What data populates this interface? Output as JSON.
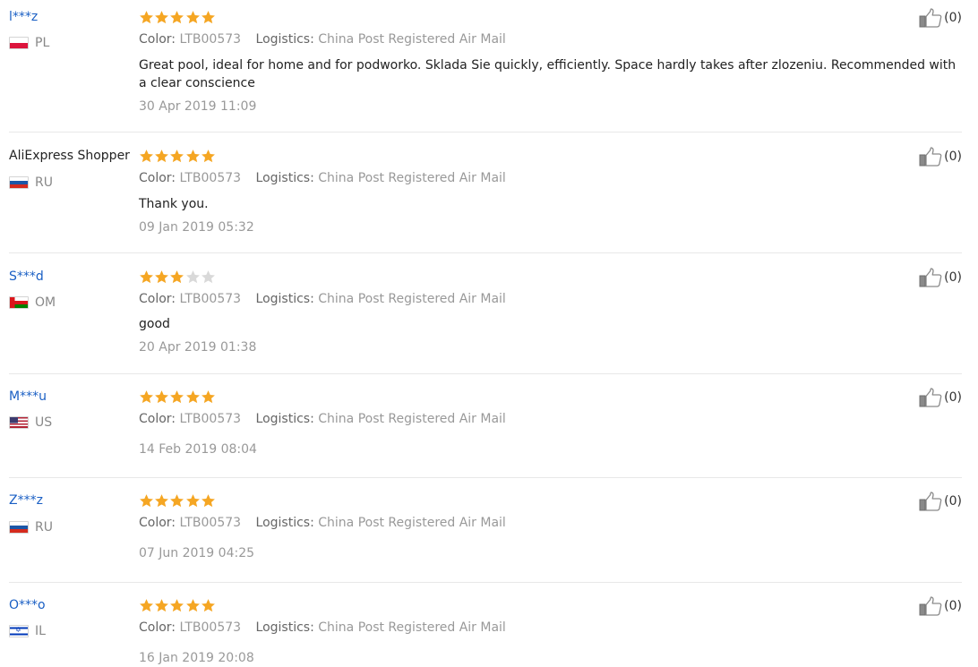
{
  "labels": {
    "color": "Color:",
    "logistics": "Logistics:"
  },
  "colors": {
    "star_filled": "#f5a623",
    "star_empty": "#d9d9d9",
    "username": "#1a5fc4"
  },
  "reviews": [
    {
      "user": "l***z",
      "country": "PL",
      "rating": 5,
      "color_value": "LTB00573",
      "logistics_value": "China Post Registered Air Mail",
      "feedback": "Great pool, ideal for home and for podworko. Sklada Sie quickly, efficiently. Space hardly takes after zlozeniu. Recommended with a clear conscience",
      "date": "30 Apr 2019 11:09",
      "helpful": "(0)"
    },
    {
      "user": "AliExpress Shopper",
      "country": "RU",
      "rating": 5,
      "color_value": "LTB00573",
      "logistics_value": "China Post Registered Air Mail",
      "feedback": "Thank you.",
      "date": "09 Jan 2019 05:32",
      "helpful": "(0)"
    },
    {
      "user": "S***d",
      "country": "OM",
      "rating": 3,
      "color_value": "LTB00573",
      "logistics_value": "China Post Registered Air Mail",
      "feedback": "good",
      "date": "20 Apr 2019 01:38",
      "helpful": "(0)"
    },
    {
      "user": "M***u",
      "country": "US",
      "rating": 5,
      "color_value": "LTB00573",
      "logistics_value": "China Post Registered Air Mail",
      "feedback": "",
      "date": "14 Feb 2019 08:04",
      "helpful": "(0)"
    },
    {
      "user": "Z***z",
      "country": "RU",
      "rating": 5,
      "color_value": "LTB00573",
      "logistics_value": "China Post Registered Air Mail",
      "feedback": "",
      "date": "07 Jun 2019 04:25",
      "helpful": "(0)"
    },
    {
      "user": "O***o",
      "country": "IL",
      "rating": 5,
      "color_value": "LTB00573",
      "logistics_value": "China Post Registered Air Mail",
      "feedback": "",
      "date": "16 Jan 2019 20:08",
      "helpful": "(0)"
    }
  ]
}
